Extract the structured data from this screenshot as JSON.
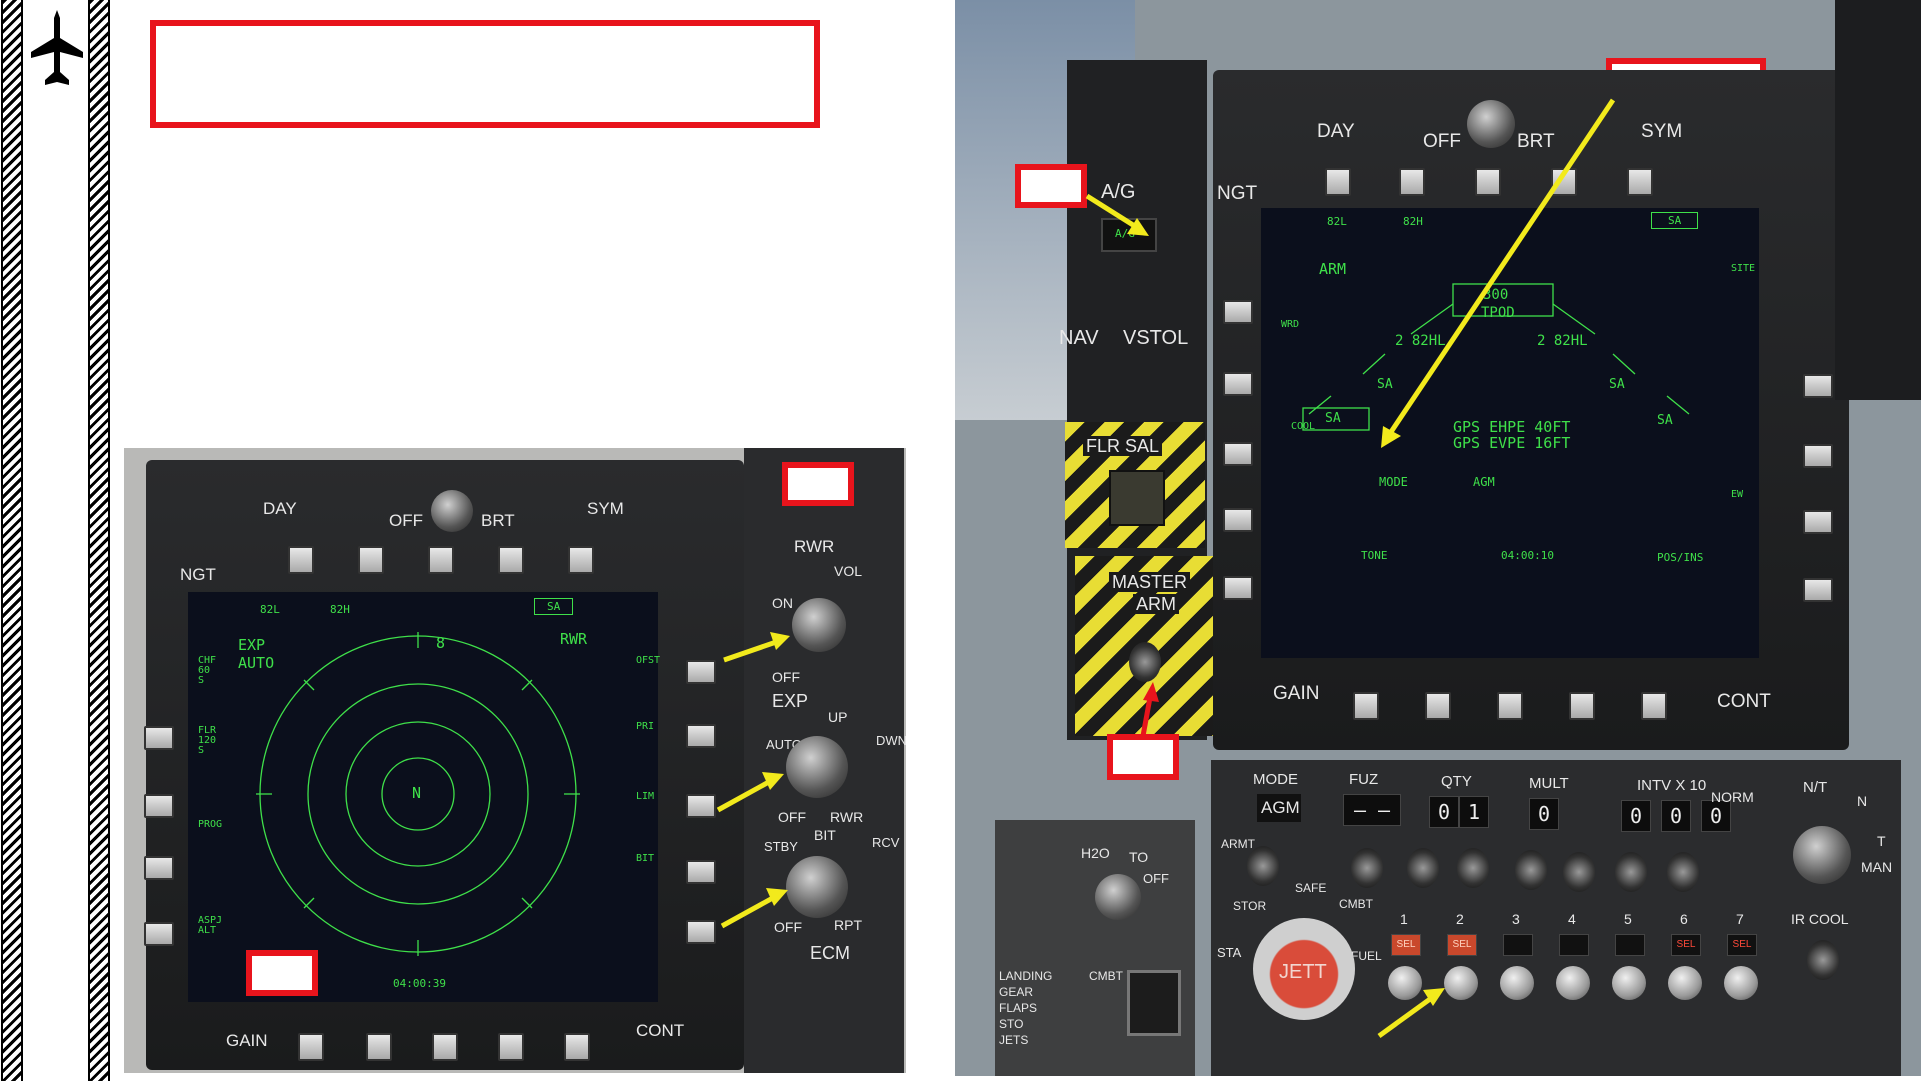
{
  "left_mfd": {
    "bezel_labels": {
      "day": "DAY",
      "brt": "BRT",
      "off": "OFF",
      "sym": "SYM",
      "ngt": "NGT",
      "gain": "GAIN",
      "cont": "CONT"
    },
    "top_labels": [
      "82L",
      "82H"
    ],
    "sa": "SA",
    "exp_auto": [
      "EXP",
      "AUTO"
    ],
    "rwr": "RWR",
    "left_side": [
      "CHF 60 S",
      "FLR 120 S",
      "PROG",
      "ASPJ ALT"
    ],
    "right_side": [
      "OFST",
      "PRI",
      "LIM",
      "BIT"
    ],
    "scale": "8",
    "north": "N",
    "time": "04:00:39"
  },
  "rwr_panel": {
    "rwr": "RWR",
    "vol": "VOL",
    "on": "ON",
    "off": "OFF",
    "exp": "EXP",
    "up": "UP",
    "dwn": "DWN",
    "auto": "AUTO",
    "off2": "OFF",
    "rwr2": "RWR",
    "stby": "STBY",
    "bit": "BIT",
    "rcv": "RCV",
    "off3": "OFF",
    "rpt": "RPT",
    "ecm": "ECM"
  },
  "right_mfd": {
    "bezel_labels": {
      "day": "DAY",
      "off": "OFF",
      "brt": "BRT",
      "sym": "SYM",
      "ngt": "NGT",
      "gain": "GAIN",
      "cont": "CONT"
    },
    "top_labels": [
      "82L",
      "82H"
    ],
    "sa_top": "SA",
    "arm": "ARM",
    "qty": "300",
    "tpod": "TPOD",
    "left_station": "2 82HL",
    "right_station": "2 82HL",
    "sa_left": "SA",
    "sa_right": "SA",
    "sa_outer_right": "SA",
    "sa_box": "SA",
    "gps_ehpe": "GPS EHPE 40FT",
    "gps_evpe": "GPS EVPE 16FT",
    "mode": "MODE",
    "agm": "AGM",
    "tone": "TONE",
    "time": "04:00:10",
    "pos": "POS/INS",
    "wrd": "WRD",
    "cool": "COOL",
    "site": "SITE",
    "ew": "EW"
  },
  "left_console": {
    "ag": "A/G",
    "ag_btn": "A/G",
    "nav": "NAV",
    "vstol": "VSTOL",
    "flr_sal": "FLR  SAL",
    "master_arm": [
      "MASTER",
      "ARM"
    ]
  },
  "armament_panel": {
    "headers": [
      "MODE",
      "FUZ",
      "QTY",
      "MULT",
      "INTV  X 10",
      "N/T"
    ],
    "mode_value": "AGM",
    "fuz_value": "– –",
    "qty_digits": [
      "0",
      "1"
    ],
    "mult_digit": "0",
    "intv_digits": [
      "0",
      "0",
      "0"
    ],
    "norm": "NORM",
    "n": "N",
    "t": "T",
    "man": "MAN",
    "armt": "ARMT",
    "stor": "STOR",
    "safe": "SAFE",
    "cmbt": "CMBT",
    "sta": "STA",
    "fuel": "FUEL",
    "jett": "JETT",
    "stations": [
      "1",
      "2",
      "3",
      "4",
      "5",
      "6",
      "7"
    ],
    "sel": "SEL",
    "ir_cool": "IR COOL",
    "h2o": "H2O",
    "to": "TO",
    "off": "OFF",
    "landing": [
      "LANDING",
      "GEAR",
      "FLAPS",
      "STO",
      "JETS"
    ],
    "cmbt2": "CMBT"
  }
}
